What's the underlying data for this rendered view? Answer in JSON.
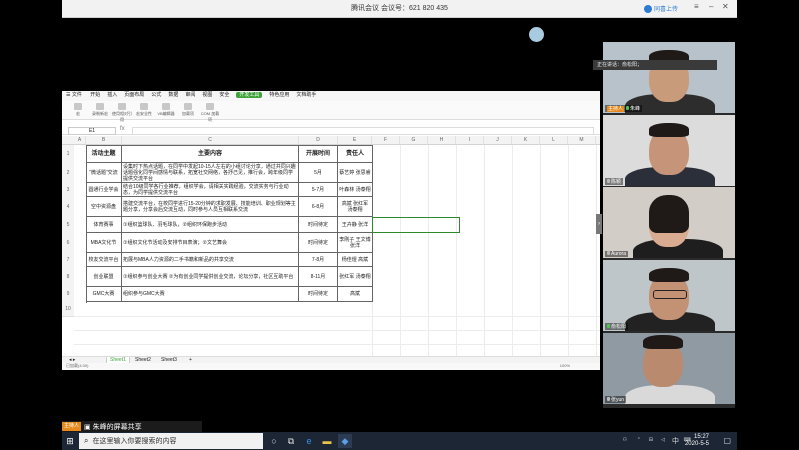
{
  "meeting": {
    "title": "腾讯会议 会议号：621 820 435",
    "upload_label": "同喜上传",
    "speaking": "正在讲话：俞松阳；"
  },
  "excel": {
    "tabs": [
      "开始",
      "插入",
      "页面布局",
      "公式",
      "数据",
      "审阅",
      "视图",
      "安全",
      "开发工具",
      "特色应用",
      "文档助手"
    ],
    "active_tab": "开发工具",
    "ribbon_buttons": [
      "宏",
      "录制新宏",
      "使用相对引用",
      "宏安全性",
      "VB编辑器",
      "加载项",
      "COM 加载项"
    ],
    "name_box": "E1",
    "fx_symbol": "fx",
    "columns": [
      "A",
      "B",
      "C",
      "D",
      "E",
      "F",
      "G",
      "H",
      "I",
      "J",
      "K",
      "L",
      "M",
      "N"
    ],
    "headers": [
      "活动主题",
      "主要内容",
      "开展时间",
      "责任人"
    ],
    "rows": [
      {
        "num": "2",
        "topic": "“微话题”交流",
        "content": "设集时下热点话题，在同学中发起10-15人左右的小组讨论分享，通过共同兴趣话题强化同学间感情与联系，拓宽社交网络，各抒己见，推行会，跨年级同学提供交流平台",
        "time": "5月",
        "owner": "蔡艺婷 张思睿"
      },
      {
        "num": "3",
        "topic": "圆通行业学会",
        "content": "结合10级同学各行业推荐，组织学会，请相关实践经验，交流实务与行业动态，为同学提供交流平台",
        "time": "5-7月",
        "owner": "叶森林 汤泰翔"
      },
      {
        "num": "4",
        "topic": "空中资源盘",
        "content": "搭建交流平台，在校同学进行15-20分钟的求职发展、技能培训、职业规划等主题分享，分享会后交流互动，同时参与人员互相联系交流",
        "time": "6-8月",
        "owner": "高斌 张红军 汤泰翔"
      },
      {
        "num": "5",
        "topic": "体育赛事",
        "content": "①组织篮球队、羽毛球队，②组织环保跑步活动",
        "time": "时间待定",
        "owner": "王卉静 张洋"
      },
      {
        "num": "6",
        "topic": "MBA文化节",
        "content": "①组织文化节活动及安排节目表演；②文艺舞会",
        "time": "时间待定",
        "owner": "李刚子 王文博 张洋"
      },
      {
        "num": "7",
        "topic": "校友交流平台",
        "content": "拓展与MBA人力资源的二手书籍和新品的共享交流",
        "time": "7-8月",
        "owner": "杨佳煜 高斌"
      },
      {
        "num": "8",
        "topic": "创业联盟",
        "content": "①组织参与创业大赛 ②为有创业同学提供创业交流，论坛分享，社区互助平台",
        "time": "8-11月",
        "owner": "张红军 汤泰翔"
      },
      {
        "num": "9",
        "topic": "GMC大赛",
        "content": "组织参与GMC大赛",
        "time": "时间待定",
        "owner": "高斌"
      }
    ],
    "sheets": [
      "Sheet1",
      "Sheet2",
      "Sheet3"
    ],
    "active_sheet": "Sheet1",
    "status_left": "已加载(4.00)",
    "status_zoom": "100%"
  },
  "participants": [
    {
      "name": "朱峰",
      "host": "主持人",
      "muted": false
    },
    {
      "name": "陈颖",
      "host": "",
      "muted": true
    },
    {
      "name": "Aurora",
      "host": "",
      "muted": true
    },
    {
      "name": "俞松阳",
      "host": "",
      "muted": false
    },
    {
      "name": "张yun",
      "host": "",
      "muted": true
    }
  ],
  "share_label": {
    "host": "主持人",
    "text": "朱峰的屏幕共享"
  },
  "taskbar": {
    "search_placeholder": "在这里输入你要搜索的内容",
    "time": "15:27",
    "date": "2020-5-5",
    "ime": "中"
  },
  "colors": {
    "accent_green": "#3fa33a",
    "taskbar": "#1c2635",
    "host_orange": "#e58a1e"
  }
}
